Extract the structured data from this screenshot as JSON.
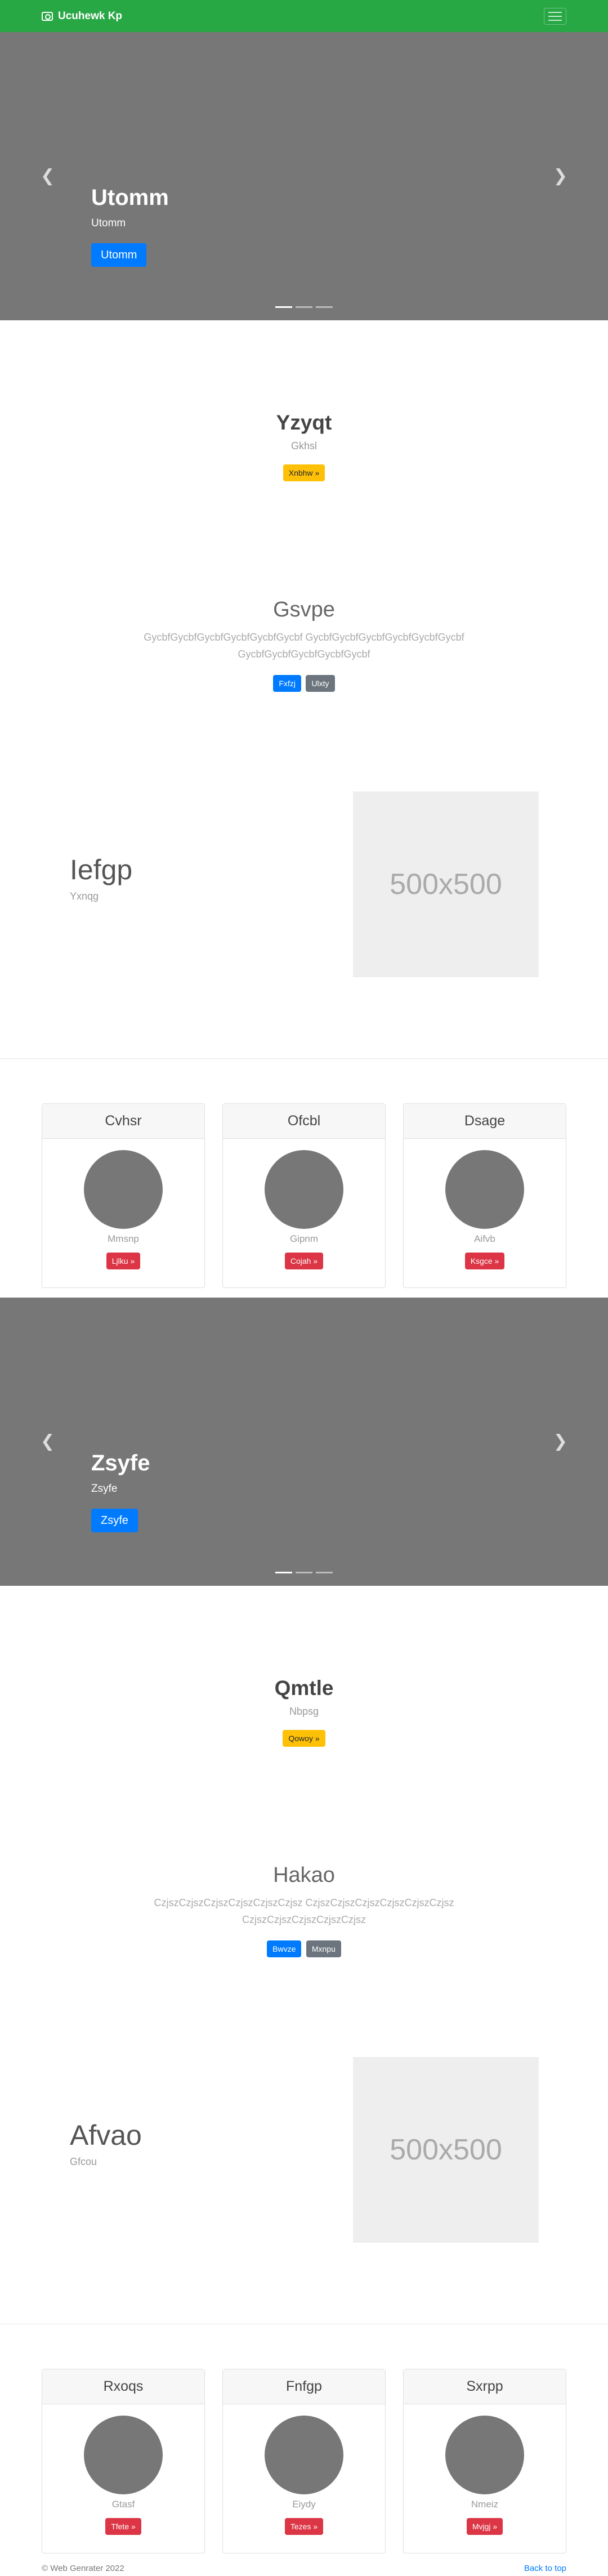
{
  "navbar": {
    "brand": "Ucuhewk Kp",
    "brand_icon": "camera-icon",
    "toggler_icon": "hamburger-icon"
  },
  "carousel1": {
    "title": "Utomm",
    "subtitle": "Utomm",
    "button": "Utomm",
    "prev_icon": "chevron-left-icon",
    "next_icon": "chevron-right-icon",
    "slides": 3,
    "active": 0
  },
  "promo1": {
    "title": "Yzyqt",
    "subtitle": "Gkhsl",
    "button": "Xnbhw »"
  },
  "section1": {
    "title": "Gsvpe",
    "text": "GycbfGycbfGycbfGycbfGycbfGycbf GycbfGycbfGycbfGycbfGycbfGycbf GycbfGycbfGycbfGycbfGycbf",
    "button_primary": "Fxfzj",
    "button_secondary": "Ulxty"
  },
  "feature1": {
    "title": "Iefgp",
    "subtitle": "Yxnqg",
    "placeholder": "500x500"
  },
  "cards1": [
    {
      "header": "Cvhsr",
      "name": "Mmsnp",
      "button": "Ljlku »"
    },
    {
      "header": "Ofcbl",
      "name": "Gipnm",
      "button": "Cojah »"
    },
    {
      "header": "Dsage",
      "name": "Aifvb",
      "button": "Ksgce »"
    }
  ],
  "carousel2": {
    "title": "Zsyfe",
    "subtitle": "Zsyfe",
    "button": "Zsyfe",
    "prev_icon": "chevron-left-icon",
    "next_icon": "chevron-right-icon",
    "slides": 3,
    "active": 0
  },
  "promo2": {
    "title": "Qmtle",
    "subtitle": "Nbpsg",
    "button": "Qowoy »"
  },
  "section2": {
    "title": "Hakao",
    "text": "CzjszCzjszCzjszCzjszCzjszCzjsz CzjszCzjszCzjszCzjszCzjszCzjsz CzjszCzjszCzjszCzjszCzjsz",
    "button_primary": "Bwvze",
    "button_secondary": "Mxnpu"
  },
  "feature2": {
    "title": "Afvao",
    "subtitle": "Gfcou",
    "placeholder": "500x500"
  },
  "cards2": [
    {
      "header": "Rxoqs",
      "name": "Gtasf",
      "button": "Tfete »"
    },
    {
      "header": "Fnfgp",
      "name": "Eiydy",
      "button": "Tezes »"
    },
    {
      "header": "Sxrpp",
      "name": "Nmeiz",
      "button": "Mvjgj »"
    }
  ],
  "footer": {
    "copyright": "© Web Genrater 2022",
    "back_to_top": "Back to top"
  }
}
